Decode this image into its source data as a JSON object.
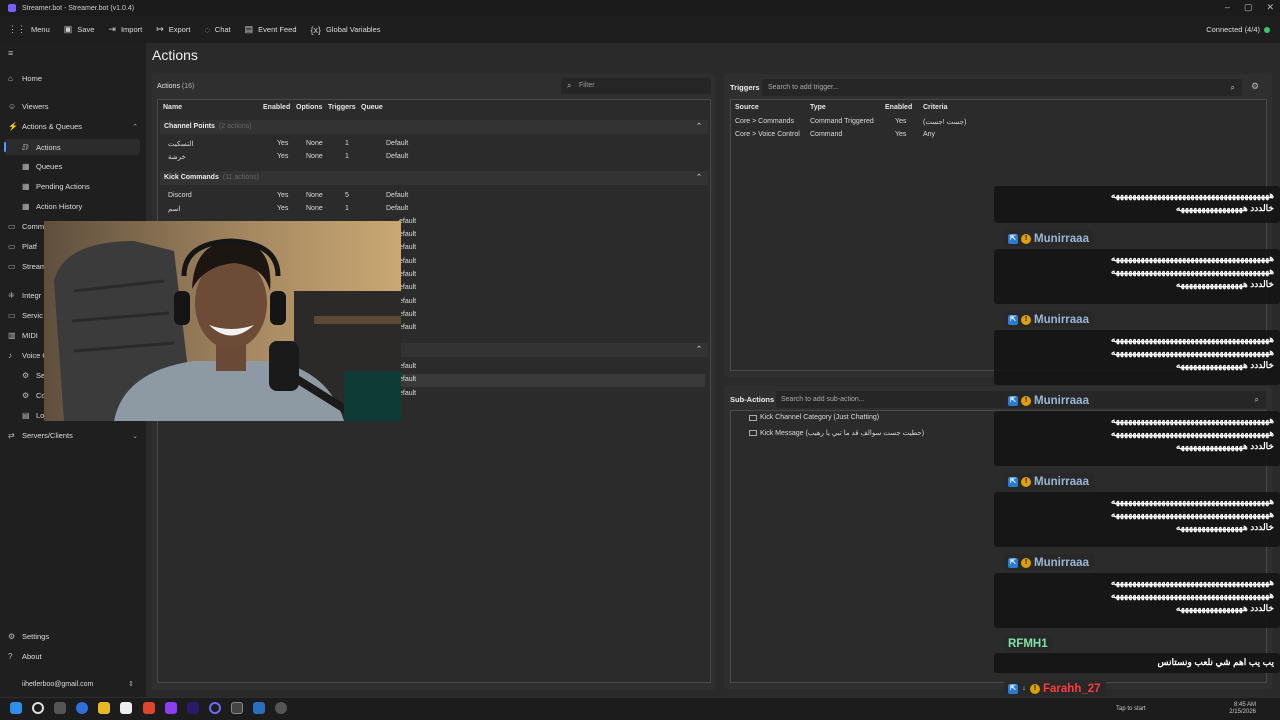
{
  "window": {
    "title": "Streamer.bot - Streamer.bot (v1.0.4)",
    "controls": [
      "–",
      "▢",
      "✕"
    ]
  },
  "toolbar": {
    "items": [
      {
        "label": "Menu",
        "icon": "grid-icon"
      },
      {
        "label": "Save",
        "icon": "save-icon"
      },
      {
        "label": "Import",
        "icon": "import-icon"
      },
      {
        "label": "Export",
        "icon": "export-icon"
      },
      {
        "label": "Chat",
        "icon": "chat-icon"
      },
      {
        "label": "Event Feed",
        "icon": "event-feed-icon"
      },
      {
        "label": "Global Variables",
        "icon": "variables-icon"
      }
    ],
    "connection": "Connected (4/4)"
  },
  "sidebar": {
    "home": "Home",
    "viewers": "Viewers",
    "actions_queues": "Actions & Queues",
    "actions": "Actions",
    "queues": "Queues",
    "pending": "Pending Actions",
    "history": "Action History",
    "commands": "Comm",
    "platforms": "Platf",
    "stream": "Stream",
    "integrations": "Integr",
    "services": "Servic",
    "midi": "MIDI",
    "voice": "Voice C",
    "voice_sub1": "Se",
    "voice_sub2": "Co",
    "voice_sub3": "Lo",
    "servers": "Servers/Clients",
    "settings": "Settings",
    "about": "About",
    "email": "iihetlerboo@gmail.com"
  },
  "page": {
    "title": "Actions"
  },
  "actions": {
    "title": "Actions",
    "count": "(16)",
    "filter_placeholder": "Filter",
    "columns": [
      "Name",
      "Enabled",
      "Options",
      "Triggers",
      "Queue"
    ],
    "groups": [
      {
        "name": "Channel Points",
        "subtitle": "(2 actions)",
        "rows": [
          {
            "name": "التسكيت",
            "enabled": "Yes",
            "options": "None",
            "triggers": "1",
            "queue": "Default"
          },
          {
            "name": "خرشة",
            "enabled": "Yes",
            "options": "None",
            "triggers": "1",
            "queue": "Default"
          }
        ]
      },
      {
        "name": "Kick Commands",
        "subtitle": "(11 actions)",
        "rows": [
          {
            "name": "Discord",
            "enabled": "Yes",
            "options": "None",
            "triggers": "5",
            "queue": "Default"
          },
          {
            "name": "اسم",
            "enabled": "Yes",
            "options": "None",
            "triggers": "1",
            "queue": "Default"
          }
        ]
      }
    ],
    "hidden_queue": [
      "efault",
      "efault",
      "efault",
      "efault",
      "efault",
      "efault",
      "efault",
      "efault",
      "efault"
    ],
    "lower_queue": [
      "efault",
      "efault",
      "efault"
    ]
  },
  "triggers": {
    "title": "Triggers",
    "search_placeholder": "Search to add trigger...",
    "columns": [
      "Source",
      "Type",
      "Enabled",
      "Criteria"
    ],
    "rows": [
      {
        "source": "Core > Commands",
        "type": "Command Triggered",
        "enabled": "Yes",
        "criteria": "(جست !جست)"
      },
      {
        "source": "Core > Voice Control",
        "type": "Command",
        "enabled": "Yes",
        "criteria": "Any"
      }
    ]
  },
  "subactions": {
    "title": "Sub-Actions",
    "search_placeholder": "Search to add sub-action...",
    "items": [
      "Kick Channel Category (Just Chatting)",
      "Kick Message (حطيت جست سوالف قد ما تبي يا رهيب)"
    ]
  },
  "chat": {
    "messages": [
      {
        "user": "",
        "text": [
          "ههههههههههههههههههههههههههههههههههههههه",
          "خالددد ههههههههههههههههه"
        ]
      },
      {
        "user": "Munirraaa",
        "text": [
          "ههههههههههههههههههههههههههههههههههههههه",
          "ههههههههههههههههههههههههههههههههههههههه",
          "خالددد ههههههههههههههههه"
        ]
      },
      {
        "user": "Munirraaa",
        "text": [
          "ههههههههههههههههههههههههههههههههههههههه",
          "ههههههههههههههههههههههههههههههههههههههه",
          "خالددد ههههههههههههههههه"
        ]
      },
      {
        "user": "Munirraaa",
        "text": [
          "ههههههههههههههههههههههههههههههههههههههه",
          "ههههههههههههههههههههههههههههههههههههههه",
          "خالددد ههههههههههههههههه"
        ]
      },
      {
        "user": "Munirraaa",
        "text": [
          "ههههههههههههههههههههههههههههههههههههههه",
          "ههههههههههههههههههههههههههههههههههههههه",
          "خالددد ههههههههههههههههه"
        ]
      },
      {
        "user": "Munirraaa",
        "text": [
          "ههههههههههههههههههههههههههههههههههههههه",
          "ههههههههههههههههههههههههههههههههههههههه",
          "خالددد ههههههههههههههههه"
        ]
      },
      {
        "user": "RFMH1",
        "text": [
          "يب يب اهم شي نلعب ونستانس"
        ]
      },
      {
        "user": "Farahh_27",
        "text": []
      }
    ]
  },
  "taskbar": {
    "tap": "Tap to start",
    "time": "8:45 AM",
    "date": "2/15/2026"
  }
}
